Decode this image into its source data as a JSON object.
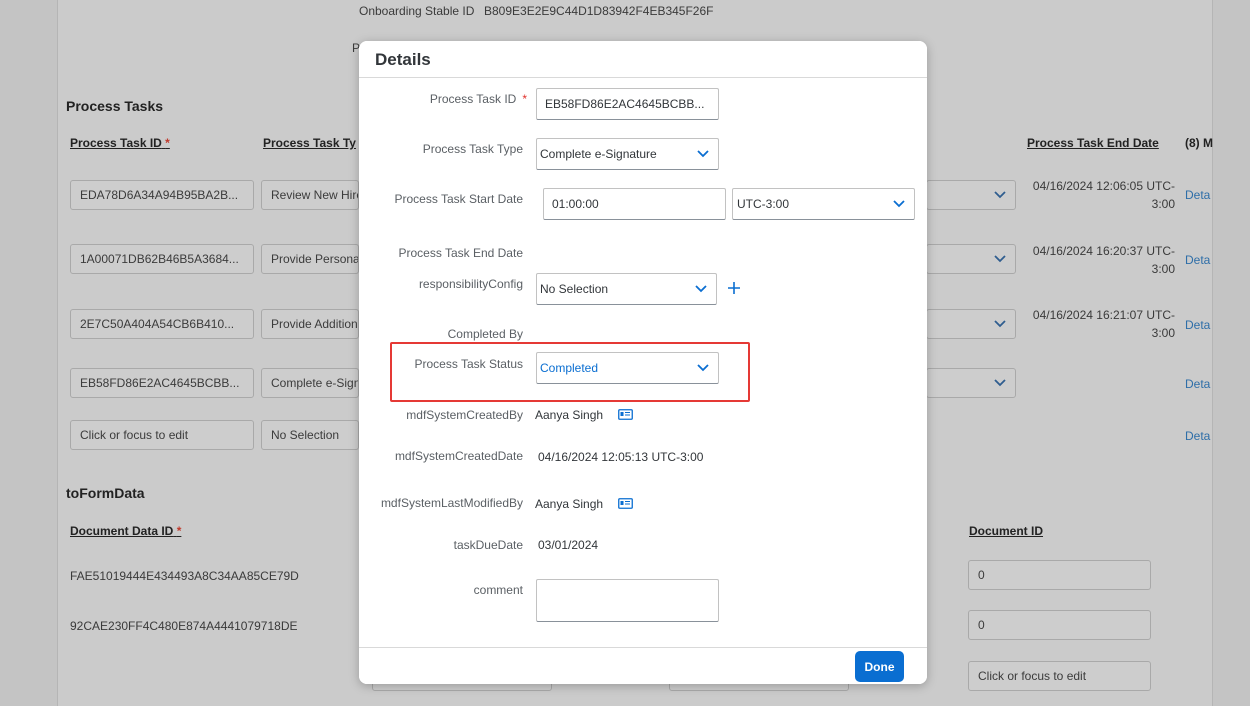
{
  "background": {
    "onboarding_label": "Onboarding Stable ID",
    "onboarding_value": "B809E3E2E9C44D1D83942F4EB345F26F",
    "partial_letter": "P",
    "process_tasks_heading": "Process Tasks",
    "columns": {
      "id": "Process Task ID",
      "type": "Process Task Ty",
      "end_date": "Process Task End Date",
      "more": "(8) M"
    },
    "rows": [
      {
        "id": "EDA78D6A34A94B95BA2B...",
        "type": "Review New Hire",
        "end_date": "04/16/2024 12:06:05 UTC-3:00",
        "link": "Deta"
      },
      {
        "id": "1A00071DB62B46B5A3684...",
        "type": "Provide Personal",
        "end_date": "04/16/2024 16:20:37 UTC-3:00",
        "link": "Deta"
      },
      {
        "id": "2E7C50A404A54CB6B410...",
        "type": "Provide Additiona",
        "end_date": "04/16/2024 16:21:07 UTC-3:00",
        "link": "Deta"
      },
      {
        "id": "EB58FD86E2AC4645BCBB...",
        "type": "Complete e-Sign",
        "end_date": "",
        "link": "Deta"
      },
      {
        "id": "Click or focus to edit",
        "type": "No Selection",
        "end_date": "",
        "link": "Deta"
      }
    ],
    "form_data_heading": "toFormData",
    "document_data_id_header": "Document Data ID",
    "document_id_header": "Document ID",
    "document_rows": [
      {
        "data_id": "FAE51019444E434493A8C34AA85CE79D",
        "doc_id": "0"
      },
      {
        "data_id": "92CAE230FF4C480E874A4441079718DE",
        "doc_id": "0"
      },
      {
        "data_id": "",
        "doc_id": "Click or focus to edit"
      }
    ]
  },
  "dialog": {
    "title": "Details",
    "required_mark": "*",
    "fields": {
      "task_id_label": "Process Task ID",
      "task_id_value": "EB58FD86E2AC4645BCBB...",
      "task_type_label": "Process Task Type",
      "task_type_value": "Complete e-Signature",
      "start_date_label": "Process Task Start Date",
      "start_time_value": "01:00:00",
      "start_tz_value": "UTC-3:00",
      "end_date_label": "Process Task End Date",
      "responsibility_label": "responsibilityConfig",
      "responsibility_value": "No Selection",
      "completed_by_label": "Completed By",
      "status_label": "Process Task Status",
      "status_value": "Completed",
      "created_by_label": "mdfSystemCreatedBy",
      "created_by_value": "Aanya Singh",
      "created_date_label": "mdfSystemCreatedDate",
      "created_date_value": "04/16/2024 12:05:13 UTC-3:00",
      "modified_by_label": "mdfSystemLastModifiedBy",
      "modified_by_value": "Aanya Singh",
      "due_date_label": "taskDueDate",
      "due_date_value": "03/01/2024",
      "comment_label": "comment",
      "comment_value": ""
    },
    "done_label": "Done"
  },
  "colors": {
    "accent": "#0a6ed1",
    "highlight": "#e53935",
    "required": "#e0302a",
    "link": "#2e6ea8"
  }
}
